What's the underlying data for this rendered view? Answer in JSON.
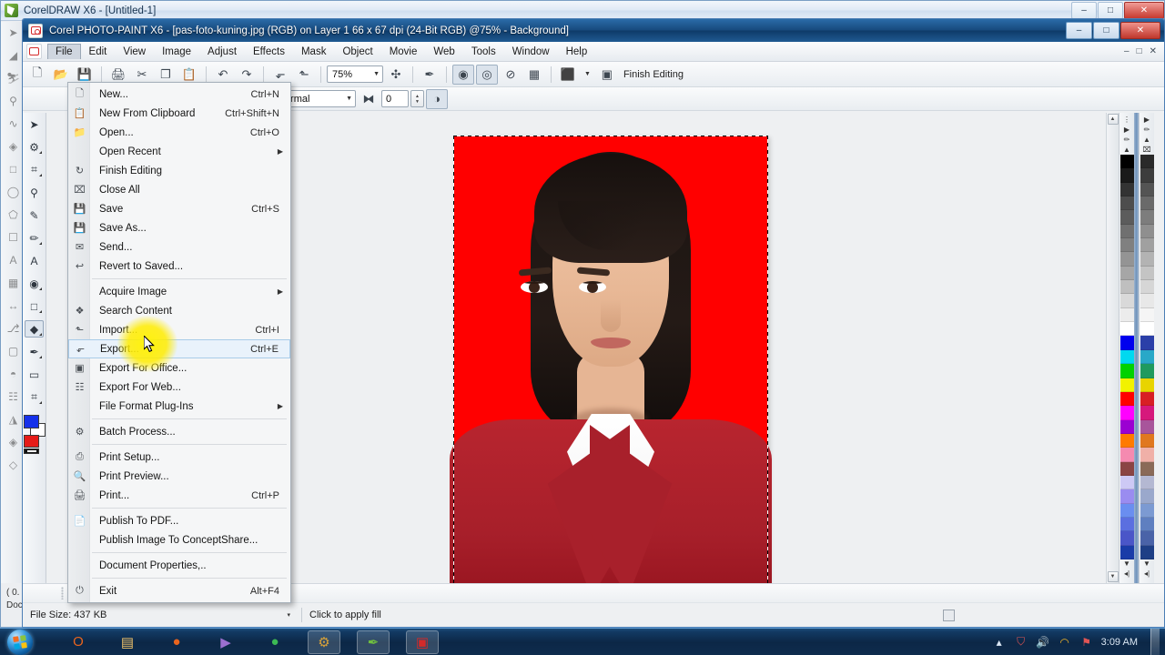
{
  "desktop": {
    "background_window": {
      "title": "CorelDRAW X6 - [Untitled-1]",
      "icon": "coreldraw-icon",
      "minimize": "–",
      "maximize": "□",
      "close": "✕",
      "status_left_1": "( 0.",
      "status_left_2": "Doc"
    }
  },
  "window": {
    "title": "Corel PHOTO-PAINT X6 - [pas-foto-kuning.jpg (RGB) on Layer 1 66 x 67 dpi  (24-Bit RGB) @75% - Background]",
    "icon": "photo-paint-icon",
    "buttons": {
      "minimize": "–",
      "maximize": "□",
      "close": "✕"
    },
    "doc_buttons": {
      "minimize": "–",
      "restore": "□",
      "close": "✕"
    }
  },
  "menubar": {
    "items": [
      {
        "label": "File",
        "accel": "F"
      },
      {
        "label": "Edit",
        "accel": "E"
      },
      {
        "label": "View",
        "accel": "V"
      },
      {
        "label": "Image",
        "accel": "I"
      },
      {
        "label": "Adjust",
        "accel": "A"
      },
      {
        "label": "Effects",
        "accel": "c"
      },
      {
        "label": "Mask",
        "accel": "k"
      },
      {
        "label": "Object",
        "accel": "O"
      },
      {
        "label": "Movie",
        "accel": "M"
      },
      {
        "label": "Web",
        "accel": "W"
      },
      {
        "label": "Tools",
        "accel": "T"
      },
      {
        "label": "Window",
        "accel": "W"
      },
      {
        "label": "Help",
        "accel": "H"
      }
    ]
  },
  "file_menu": {
    "groups": [
      [
        {
          "label": "New...",
          "accel": "Ctrl+N",
          "icon": "new-document-icon",
          "submenu": false
        },
        {
          "label": "New From Clipboard",
          "accel": "Ctrl+Shift+N",
          "icon": "clipboard-icon",
          "submenu": false
        },
        {
          "label": "Open...",
          "accel": "Ctrl+O",
          "icon": "open-folder-icon",
          "submenu": false
        },
        {
          "label": "Open Recent",
          "accel": "",
          "icon": "",
          "submenu": true
        },
        {
          "label": "Finish Editing",
          "accel": "",
          "icon": "finish-editing-icon",
          "submenu": false
        },
        {
          "label": "Close All",
          "accel": "",
          "icon": "close-all-icon",
          "submenu": false
        },
        {
          "label": "Save",
          "accel": "Ctrl+S",
          "icon": "save-icon",
          "submenu": false
        },
        {
          "label": "Save As...",
          "accel": "",
          "icon": "save-as-icon",
          "submenu": false
        },
        {
          "label": "Send...",
          "accel": "",
          "icon": "send-mail-icon",
          "submenu": false
        },
        {
          "label": "Revert to Saved...",
          "accel": "",
          "icon": "revert-icon",
          "submenu": false
        }
      ],
      [
        {
          "label": "Acquire Image",
          "accel": "",
          "icon": "",
          "submenu": true
        },
        {
          "label": "Search Content",
          "accel": "",
          "icon": "search-content-icon",
          "submenu": false
        },
        {
          "label": "Import...",
          "accel": "Ctrl+I",
          "icon": "import-icon",
          "submenu": false
        },
        {
          "label": "Export...",
          "accel": "Ctrl+E",
          "icon": "export-icon",
          "submenu": false,
          "highlighted": true
        },
        {
          "label": "Export For Office...",
          "accel": "",
          "icon": "export-office-icon",
          "submenu": false
        },
        {
          "label": "Export For Web...",
          "accel": "",
          "icon": "export-web-icon",
          "submenu": false
        },
        {
          "label": "File Format Plug-Ins",
          "accel": "",
          "icon": "",
          "submenu": true
        }
      ],
      [
        {
          "label": "Batch Process...",
          "accel": "",
          "icon": "batch-process-icon",
          "submenu": false
        }
      ],
      [
        {
          "label": "Print Setup...",
          "accel": "",
          "icon": "print-setup-icon",
          "submenu": false
        },
        {
          "label": "Print Preview...",
          "accel": "",
          "icon": "print-preview-icon",
          "submenu": false
        },
        {
          "label": "Print...",
          "accel": "Ctrl+P",
          "icon": "print-icon",
          "submenu": false
        }
      ],
      [
        {
          "label": "Publish To PDF...",
          "accel": "",
          "icon": "pdf-icon",
          "submenu": false
        },
        {
          "label": "Publish Image To ConceptShare...",
          "accel": "",
          "icon": "",
          "submenu": false
        }
      ],
      [
        {
          "label": "Document Properties,..",
          "accel": "",
          "icon": "",
          "submenu": false
        }
      ],
      [
        {
          "label": "Exit",
          "accel": "Alt+F4",
          "icon": "exit-icon",
          "submenu": false
        }
      ]
    ]
  },
  "toolbar": {
    "zoom_value": "75%",
    "finish_editing_label": "Finish Editing",
    "buttons": [
      {
        "name": "import-button",
        "glyph": "⬐"
      },
      {
        "name": "export-button",
        "glyph": "⬑"
      },
      {
        "name": "fit-to-window-button",
        "glyph": "✣"
      },
      {
        "name": "clear-mask-button",
        "glyph": "✒"
      },
      {
        "name": "mask-overlay-button",
        "glyph": "◉"
      },
      {
        "name": "mask-marquee-button",
        "glyph": "◎"
      },
      {
        "name": "remove-mask-button",
        "glyph": "⊘"
      },
      {
        "name": "mask-edit-button",
        "glyph": "▦"
      },
      {
        "name": "publish-button",
        "glyph": "⬛"
      },
      {
        "name": "finish-editing-icon",
        "glyph": "▣"
      }
    ]
  },
  "property_bar": {
    "mode_value": "Normal",
    "tolerance_value": "0",
    "buttons": [
      {
        "name": "brush-size-spinner",
        "glyph": "▴"
      },
      {
        "name": "feather-icon",
        "glyph": "⧓"
      },
      {
        "name": "antialias-button",
        "glyph": "◑"
      }
    ]
  },
  "toolbox": {
    "tools": [
      {
        "name": "pick-tool",
        "glyph": "➤"
      },
      {
        "name": "mask-transform-tool",
        "glyph": "⚙"
      },
      {
        "name": "crop-tool",
        "glyph": "⌗"
      },
      {
        "name": "zoom-tool",
        "glyph": "⚲"
      },
      {
        "name": "eyedropper-tool",
        "glyph": "✎"
      },
      {
        "name": "paint-tool",
        "glyph": "✏"
      },
      {
        "name": "text-tool",
        "glyph": "A"
      },
      {
        "name": "red-eye-removal-tool",
        "glyph": "◉"
      },
      {
        "name": "rectangle-mask-tool",
        "glyph": "□"
      },
      {
        "name": "fill-tool",
        "glyph": "◆",
        "selected": true
      },
      {
        "name": "interactive-fill-tool",
        "glyph": "✒"
      },
      {
        "name": "eraser-tool",
        "glyph": "▭"
      },
      {
        "name": "clone-tool",
        "glyph": "⌗"
      },
      {
        "name": "effect-tool",
        "glyph": "☁"
      }
    ],
    "fill_color": "#1531ea",
    "outline_color": "#e51b18"
  },
  "canvas": {
    "image_background_color": "#ff0000",
    "selection": "dashed-marquee"
  },
  "palette": {
    "column_a": [
      "#000000",
      "#1a1a1a",
      "#333333",
      "#4d4d4d",
      "#5c5c5c",
      "#707070",
      "#808080",
      "#949494",
      "#a6a6a6",
      "#bfbfbf",
      "#d9d9d9",
      "#ececec",
      "#ffffff",
      "#0000ee",
      "#00d9f0",
      "#00d200",
      "#f2f200",
      "#ff0000",
      "#ff00ff",
      "#9b00d2",
      "#ff7a00",
      "#f58ab0",
      "#8a4444",
      "#cdc9f5",
      "#9a8cf0",
      "#6a8ef0",
      "#5b6fe0",
      "#4a56c8",
      "#1a3ca8"
    ],
    "column_b": [
      "#2a2a2a",
      "#3d3d3d",
      "#545454",
      "#6a6a6a",
      "#7d7d7d",
      "#8f8f8f",
      "#a0a0a0",
      "#b3b3b3",
      "#c4c4c4",
      "#d6d6d6",
      "#e8e8e8",
      "#f5f5f5",
      "#ffffff",
      "#2b3fa8",
      "#29a8c8",
      "#1f9a5e",
      "#e8d400",
      "#d81f24",
      "#d6187c",
      "#a8559b",
      "#e07820",
      "#f0b0a8",
      "#8a6a58",
      "#b4b8d2",
      "#9aa8cc",
      "#7c9ad2",
      "#5f7fc0",
      "#4a63a8",
      "#1e3f86"
    ],
    "no_color": "⌧"
  },
  "fill_bar": {
    "play_icon": "▶",
    "eyedropper_icon": "✒",
    "swatch_color": "#ee1111"
  },
  "statusbar": {
    "file_size_label": "File Size: 437 KB",
    "hint": "Click to apply fill",
    "dropdown_caret": "▾"
  },
  "taskbar": {
    "start": "start-orb",
    "items": [
      {
        "name": "taskbar-item-opera",
        "glyph": "O",
        "color": "#e8641e"
      },
      {
        "name": "taskbar-item-explorer",
        "glyph": "▤",
        "color": "#f0c36a"
      },
      {
        "name": "taskbar-item-firefox",
        "glyph": "●",
        "color": "#e8641e"
      },
      {
        "name": "taskbar-item-media",
        "glyph": "▶",
        "color": "#9b6fd0"
      },
      {
        "name": "taskbar-item-chrome",
        "glyph": "●",
        "color": "#3cba54"
      },
      {
        "name": "taskbar-item-tool",
        "glyph": "⚙",
        "color": "#d8a23a",
        "open": true
      },
      {
        "name": "taskbar-item-coreldraw",
        "glyph": "✒",
        "color": "#6fbf3f",
        "open": true
      },
      {
        "name": "taskbar-item-photopaint",
        "glyph": "▣",
        "color": "#d42a2a",
        "open": true
      }
    ],
    "tray": {
      "show_hidden": "▴",
      "icons": [
        {
          "name": "tray-icon-antivirus",
          "glyph": "⛉"
        },
        {
          "name": "tray-icon-volume",
          "glyph": "🔊"
        },
        {
          "name": "tray-icon-network",
          "glyph": "◠"
        },
        {
          "name": "tray-icon-action-center",
          "glyph": "⚑"
        }
      ],
      "clock": "3:09 AM"
    }
  }
}
